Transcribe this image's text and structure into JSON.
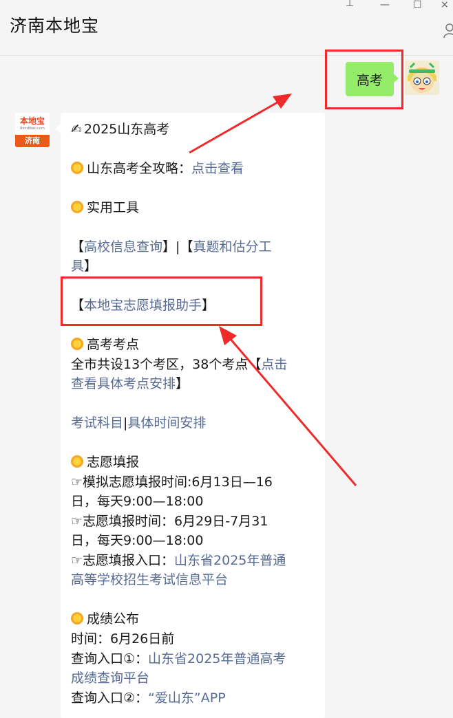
{
  "window": {
    "title": "济南本地宝",
    "controls": {
      "pin": "⊥",
      "minimize": "—",
      "maximize": "☐",
      "close": "×"
    }
  },
  "chat": {
    "my_message": "高考",
    "account_logo": {
      "name": "本地宝",
      "url": "Bendibao.com",
      "city": "济南"
    },
    "reply": {
      "heading": "2025山东高考",
      "guide_label": "山东高考全攻略：",
      "guide_link": "点击查看",
      "tools_heading": "实用工具",
      "tools_line1_a": "【",
      "tools_link1": "高校信息查询",
      "tools_line1_b": "】|【",
      "tools_link2_a": "真题和估分工",
      "tools_link2_b": "具",
      "tools_line2_end": "】",
      "helper_open": "【",
      "helper_link": "本地宝志愿填报助手",
      "helper_close": "】",
      "exam_site_heading": "高考考点",
      "exam_site_text": "全市共设13个考区，38个考点【",
      "exam_site_link_a": "点击",
      "exam_site_link_b": "查看具体考点安排",
      "exam_site_close": "】",
      "subjects_link": "考试科目",
      "subjects_sep": "|",
      "schedule_link": "具体时间安排",
      "volunteer_heading": "志愿填报",
      "mock_line1": "☞模拟志愿填报时间:6月13日—16",
      "mock_line2": "日，每天9:00—18:00",
      "real_line1": "☞志愿填报时间：6月29日-7月31",
      "real_line2": "日，每天9:00—18:00",
      "entry_label": "☞志愿填报入口：",
      "entry_link_a": "山东省2025年普通",
      "entry_link_b": "高等学校招生考试信息平台",
      "score_heading": "成绩公布",
      "score_time": "时间：6月26日前",
      "query1_label": "查询入口①：",
      "query1_link_a": "山东省2025年普通高考",
      "query1_link_b": "成绩查询平台",
      "query2_label": "查询入口②：",
      "query2_link": "“爱山东”APP"
    }
  },
  "colors": {
    "my_bubble": "#95ec69",
    "link": "#576b95",
    "annotation": "#ee2a2a"
  }
}
